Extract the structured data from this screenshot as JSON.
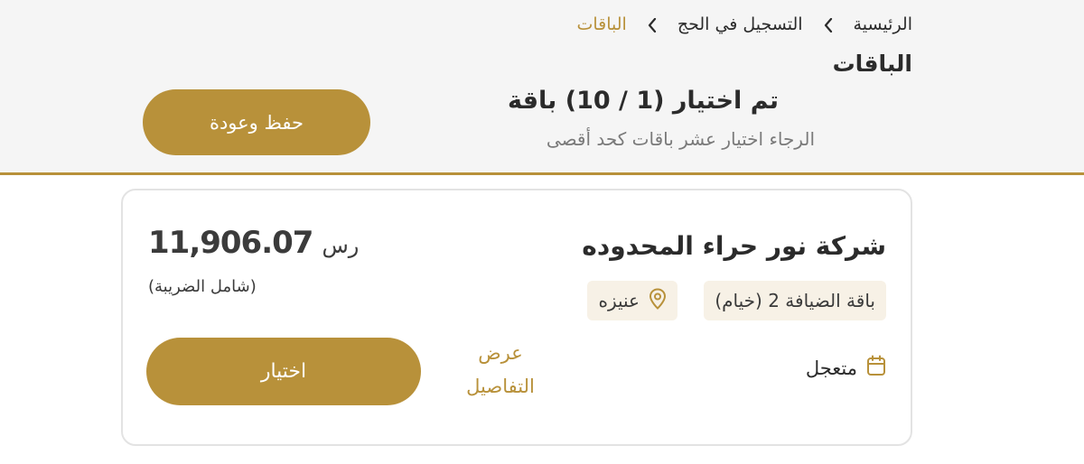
{
  "breadcrumb": {
    "items": [
      {
        "label": "الرئيسية"
      },
      {
        "label": "التسجيل في الحج"
      },
      {
        "label": "الباقات"
      }
    ]
  },
  "page": {
    "title": "الباقات",
    "selected_count": "تم اختيار (1 / 10) باقة",
    "hint": "الرجاء اختيار عشر باقات كحد أقصى",
    "save_back_label": "حفظ وعودة"
  },
  "package": {
    "company": "شركة نور حراء المحدوده",
    "package_name": "باقة الضيافة 2 (خيام)",
    "city": "عنيزه",
    "category": "متعجل",
    "details_link": "عرض التفاصيل",
    "price": "11,906.07",
    "currency": "رس",
    "tax_note": "(شامل الضريبة)",
    "choose_label": "اختيار"
  },
  "colors": {
    "accent": "#b8913a",
    "tag_bg": "#f7f1e6",
    "header_bg": "#f5f5f5"
  },
  "icons": {
    "chevron": "chevron-left-icon",
    "location": "location-pin-icon",
    "calendar": "calendar-icon"
  }
}
